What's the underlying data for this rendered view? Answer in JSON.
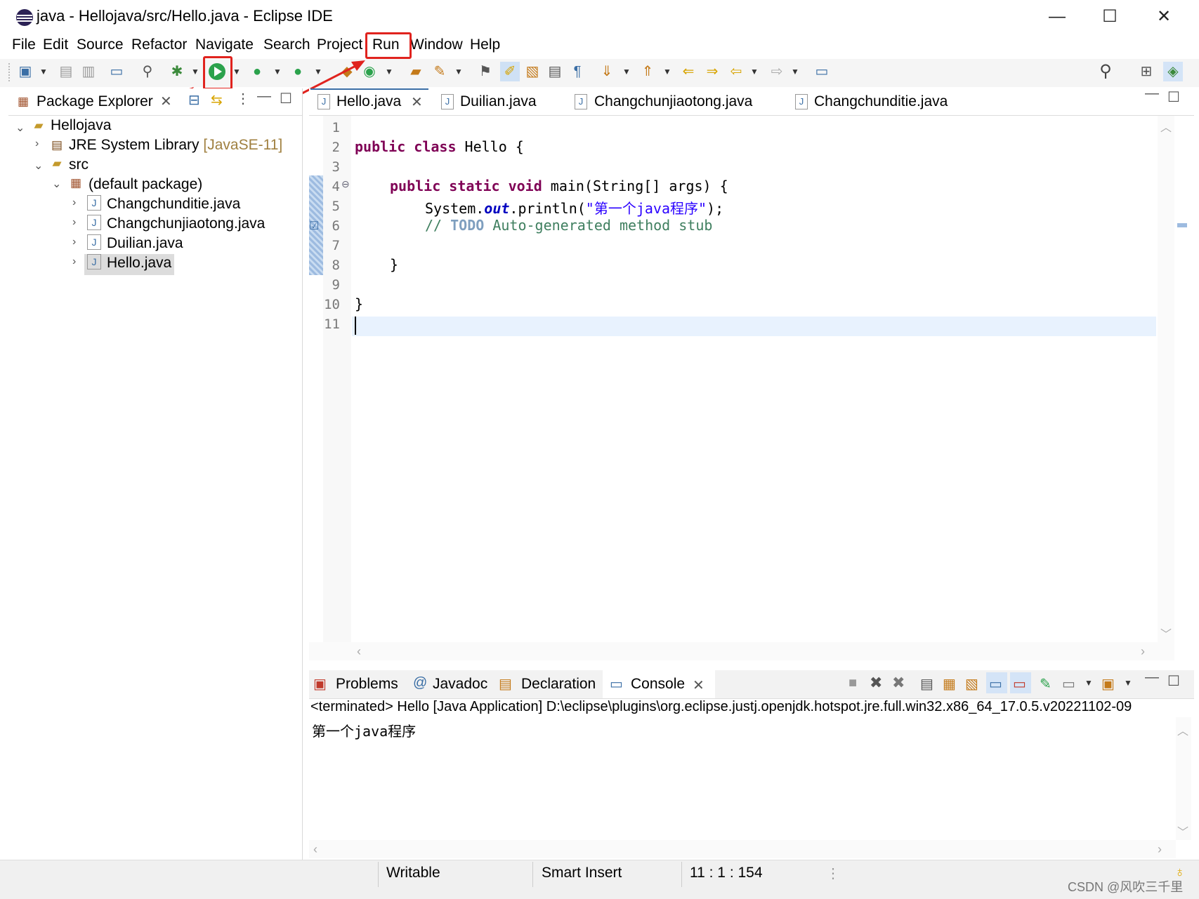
{
  "window": {
    "title": "java - Hellojava/src/Hello.java - Eclipse IDE",
    "controls": [
      "—",
      "☐",
      "✕"
    ]
  },
  "menu": [
    "File",
    "Edit",
    "Source",
    "Refactor",
    "Navigate",
    "Search",
    "Project",
    "Run",
    "Window",
    "Help"
  ],
  "package_explorer": {
    "title": "Package Explorer",
    "project": "Hellojava",
    "jre": "JRE System Library",
    "jre_version": "[JavaSE-11]",
    "src": "src",
    "package": "(default package)",
    "files": [
      "Changchunditie.java",
      "Changchunjiaotong.java",
      "Duilian.java",
      "Hello.java"
    ]
  },
  "editor": {
    "tabs": [
      "Hello.java",
      "Duilian.java",
      "Changchunjiaotong.java",
      "Changchunditie.java"
    ],
    "line_numbers": [
      "1",
      "2",
      "3",
      "4",
      "5",
      "6",
      "7",
      "8",
      "9",
      "10",
      "11"
    ],
    "code": {
      "l2_kw1": "public",
      "l2_kw2": "class",
      "l2_rest": " Hello {",
      "l4_kw1": "public",
      "l4_kw2": "static",
      "l4_kw3": "void",
      "l4_rest": " main(String[] args) {",
      "l5_a": "System.",
      "l5_field": "out",
      "l5_b": ".println(",
      "l5_str": "\"第一个java程序\"",
      "l5_c": ");",
      "l6_slashes": "// ",
      "l6_todo": "TODO",
      "l6_rest": " Auto-generated method stub",
      "l8": "}",
      "l10": "}"
    }
  },
  "console": {
    "tabs": [
      "Problems",
      "Javadoc",
      "Declaration",
      "Console"
    ],
    "header": "<terminated> Hello [Java Application] D:\\eclipse\\plugins\\org.eclipse.justj.openjdk.hotspot.jre.full.win32.x86_64_17.0.5.v20221102-09",
    "output": "第一个java程序"
  },
  "status": {
    "mode": "Writable",
    "insert": "Smart Insert",
    "position": "11 : 1 : 154"
  },
  "watermark": "CSDN @风吹三千里",
  "colors": {
    "keyword": "#7f0055",
    "string": "#2a00ff",
    "comment": "#3f7f5f",
    "annotation_red": "#e0231e",
    "current_line": "#e8f2fe"
  }
}
